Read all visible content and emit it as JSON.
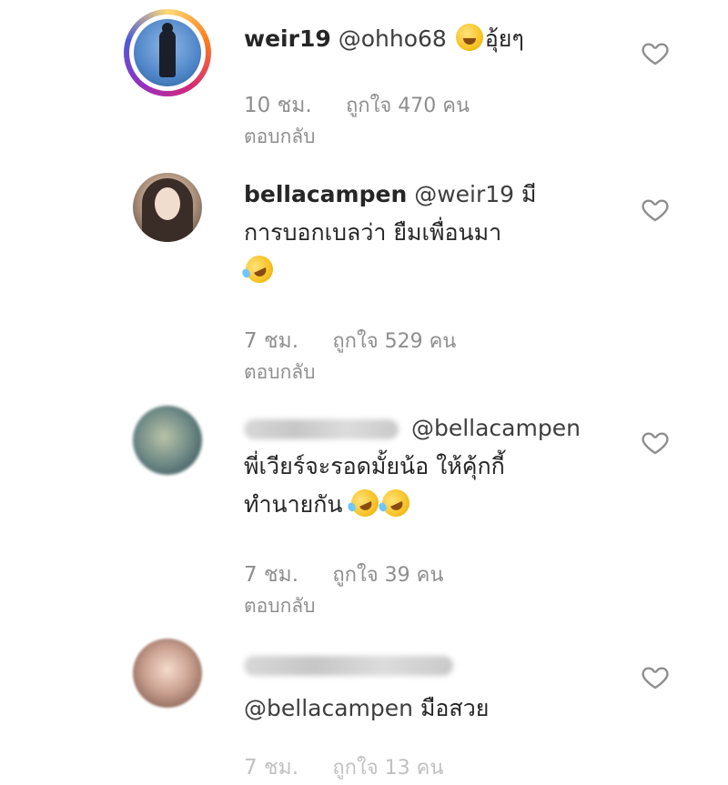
{
  "comments": [
    {
      "username": "weir19",
      "mention": "@ohho68",
      "text": "อุ้ยๆ",
      "time": "10 ชม.",
      "likes": "ถูกใจ 470 คน",
      "reply": "ตอบกลับ",
      "avatar_icon": "profile-photo-ring"
    },
    {
      "username": "bellacampen",
      "mention": "@weir19",
      "text_line1": "มี",
      "text_line2": "การบอกเบลว่า ยืมเพื่อนมา",
      "time": "7 ชม.",
      "likes": "ถูกใจ 529 คน",
      "reply": "ตอบกลับ"
    },
    {
      "username": "",
      "mention": "@bellacampen",
      "text_line1": "พี่เวียร์จะรอดมั้ยน้อ ให้คุ้กกี้",
      "text_line2": "ทำนายกัน",
      "time": "7 ชม.",
      "likes": "ถูกใจ 39 คน",
      "reply": "ตอบกลับ"
    },
    {
      "username": "",
      "mention": "@bellacampen",
      "text": "มือสวย",
      "time": "7 ชม.",
      "likes": "ถูกใจ 13 คน"
    }
  ],
  "colors": {
    "text": "#262626",
    "meta": "#8e8e8e",
    "heart": "#8e8e8e"
  }
}
